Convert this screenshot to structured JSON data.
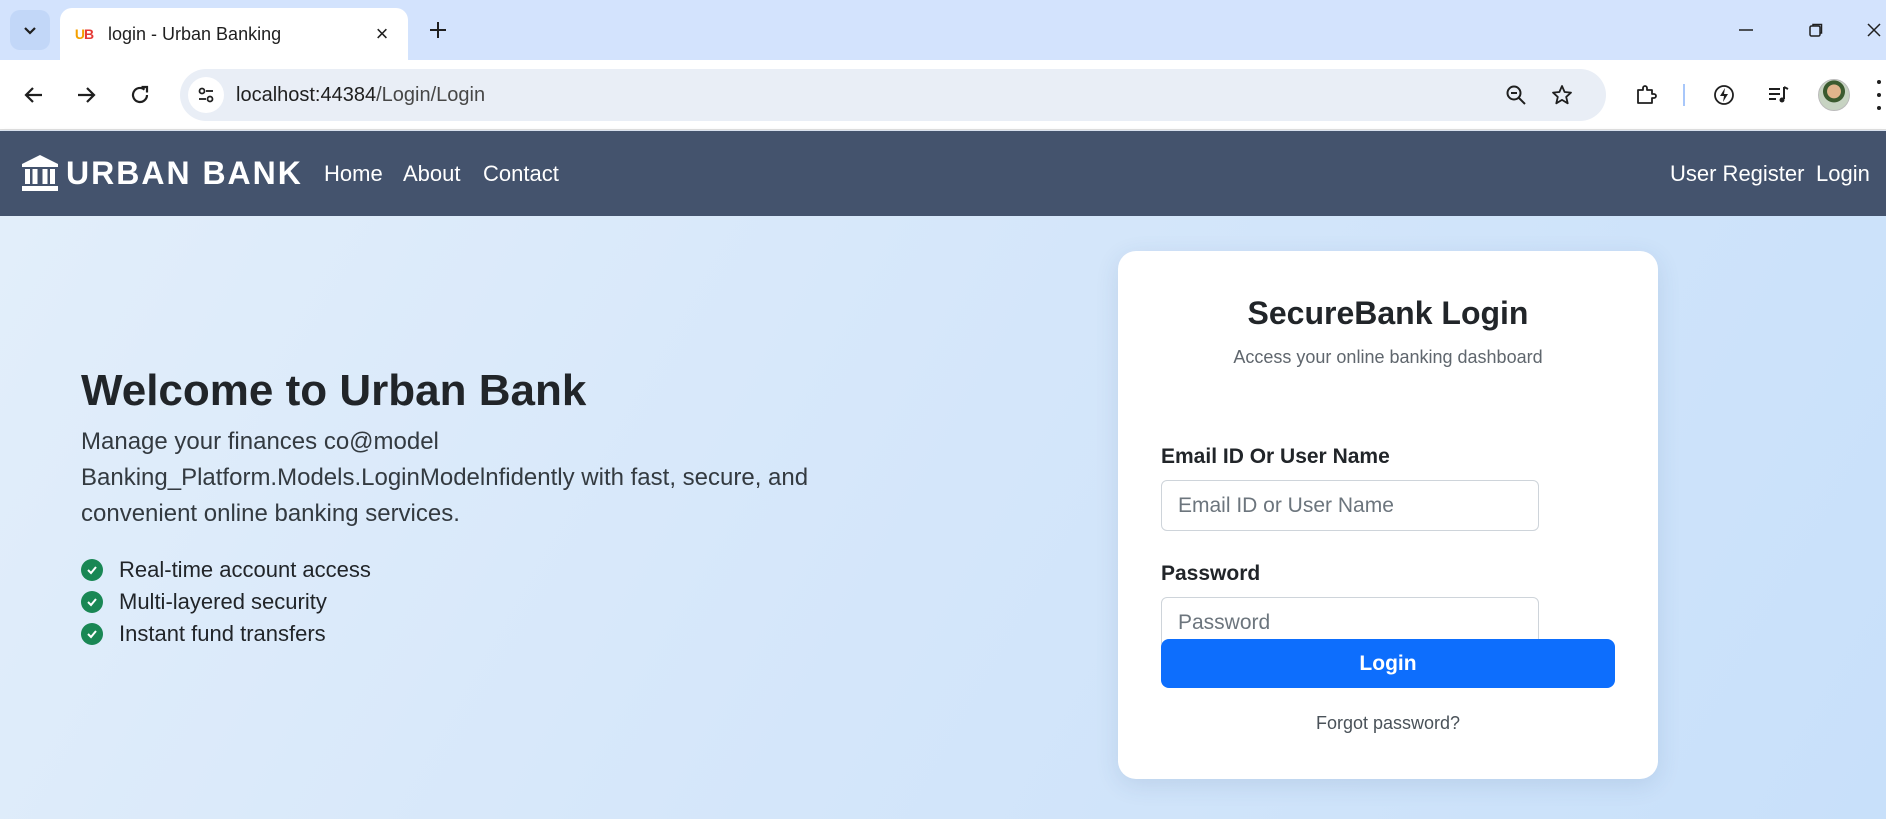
{
  "browser": {
    "tab": {
      "title": "login - Urban Banking",
      "favicon_text": [
        "U",
        "B"
      ]
    },
    "url": {
      "host": "localhost:44384",
      "path": "/Login/Login"
    },
    "icons": [
      "tab-search-icon",
      "close-icon",
      "plus-icon",
      "minimize-icon",
      "restore-icon",
      "close-window-icon",
      "back-icon",
      "forward-icon",
      "reload-icon",
      "site-settings-icon",
      "zoom-icon",
      "star-icon",
      "extensions-icon",
      "performance-icon",
      "media-icon",
      "avatar",
      "menu-icon"
    ]
  },
  "navbar": {
    "brand": "URBAN BANK",
    "links": [
      "Home",
      "About",
      "Contact"
    ],
    "right_links": [
      "User Register",
      "Login"
    ]
  },
  "hero": {
    "title": "Welcome to Urban Bank",
    "text": "Manage your finances co@model Banking_Platform.Models.LoginModelnfidently with fast, secure, and convenient online banking services.",
    "features": [
      "Real-time account access",
      "Multi-layered security",
      "Instant fund transfers"
    ]
  },
  "login": {
    "title": "SecureBank Login",
    "subtitle": "Access your online banking dashboard",
    "email_label": "Email ID Or User Name",
    "email_placeholder": "Email ID or User Name",
    "email_value": "",
    "password_label": "Password",
    "password_placeholder": "Password",
    "password_value": "",
    "button": "Login",
    "forgot": "Forgot password?"
  },
  "colors": {
    "navbar": "#44536d",
    "primary": "#0d6efd",
    "check": "#198754"
  }
}
